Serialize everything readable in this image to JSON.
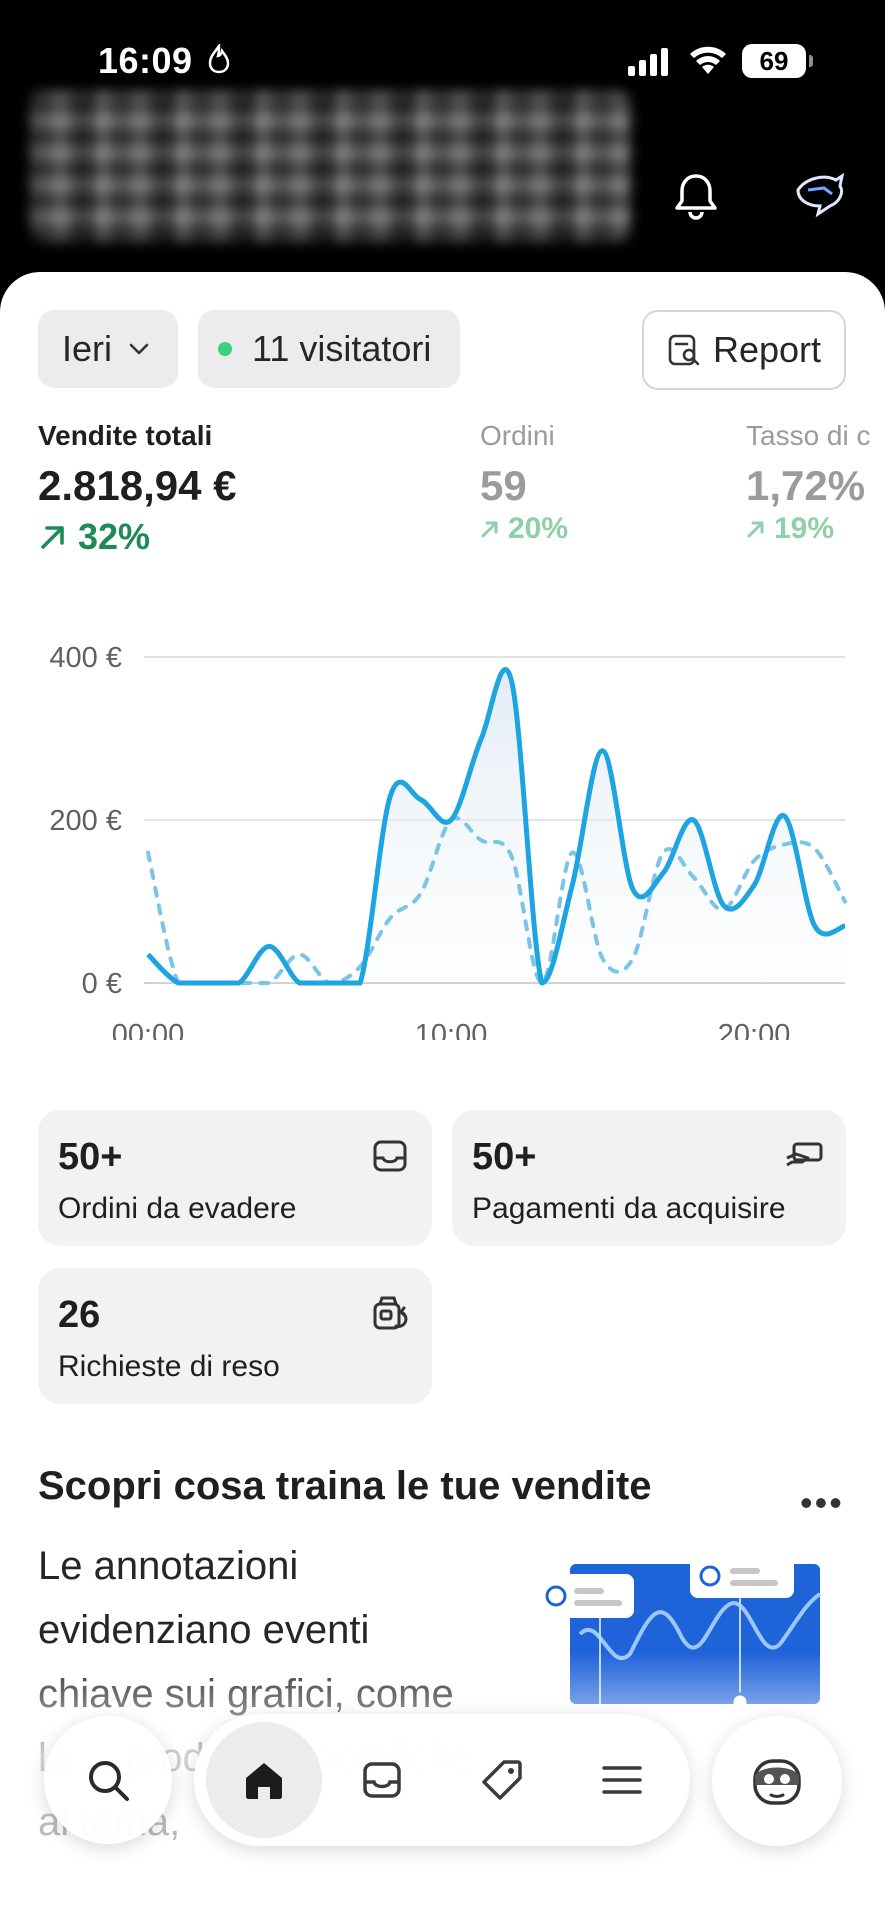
{
  "status_bar": {
    "time": "16:09",
    "battery": "69"
  },
  "filters": {
    "date": "Ieri",
    "visitors": "11 visitatori",
    "report": "Report"
  },
  "metrics": [
    {
      "label": "Vendite totali",
      "value": "2.818,94 €",
      "delta": "32%"
    },
    {
      "label": "Ordini",
      "value": "59",
      "delta": "20%"
    },
    {
      "label": "Tasso di c",
      "value": "1,72%",
      "delta": "19%"
    }
  ],
  "chart_data": {
    "type": "line",
    "x": [
      "00:00",
      "01:00",
      "02:00",
      "03:00",
      "04:00",
      "05:00",
      "06:00",
      "07:00",
      "08:00",
      "09:00",
      "10:00",
      "11:00",
      "12:00",
      "13:00",
      "14:00",
      "15:00",
      "16:00",
      "17:00",
      "18:00",
      "19:00",
      "20:00",
      "21:00",
      "22:00",
      "23:00"
    ],
    "xticks": [
      "00:00",
      "10:00",
      "20:00"
    ],
    "yticks": [
      "400 €",
      "200 €",
      "0 €"
    ],
    "ylim": [
      0,
      400
    ],
    "series": [
      {
        "values": [
          35,
          0,
          0,
          0,
          45,
          0,
          0,
          0,
          230,
          225,
          200,
          300,
          370,
          0,
          120,
          285,
          115,
          135,
          200,
          95,
          120,
          205,
          70,
          70
        ]
      },
      {
        "values": [
          160,
          0,
          0,
          0,
          0,
          35,
          0,
          20,
          80,
          110,
          200,
          175,
          155,
          0,
          160,
          30,
          30,
          160,
          130,
          90,
          150,
          170,
          165,
          100
        ]
      }
    ]
  },
  "cards": [
    {
      "count": "50+",
      "label": "Ordini da evadere",
      "icon": "inbox-icon"
    },
    {
      "count": "50+",
      "label": "Pagamenti da acquisire",
      "icon": "payment-hand-icon"
    },
    {
      "count": "26",
      "label": "Richieste di reso",
      "icon": "return-icon"
    }
  ],
  "promo": {
    "title": "Scopri cosa traina le tue vendite",
    "more": "•••",
    "body": "Le annotazioni evidenziano eventi chiave sui grafici, come la ... prodotti e modifiche al tema,"
  },
  "nav": [
    "search-icon",
    "home-icon",
    "inbox-icon",
    "tag-icon",
    "menu-icon",
    "sidekick-icon"
  ]
}
